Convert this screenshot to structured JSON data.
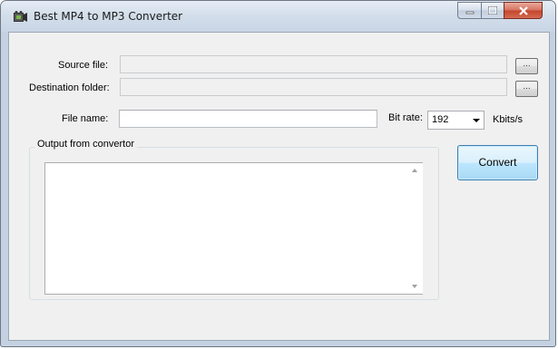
{
  "window": {
    "title": "Best MP4 to MP3 Converter",
    "app_icon": "film-icon",
    "controls": [
      "minimize-icon",
      "maximize-icon",
      "close-icon"
    ]
  },
  "form": {
    "source_file": {
      "label": "Source file:",
      "value": "",
      "browse_label": "..."
    },
    "destination_folder": {
      "label": "Destination folder:",
      "value": "",
      "browse_label": "..."
    },
    "file_name": {
      "label": "File name:",
      "value": ""
    },
    "bit_rate": {
      "label": "Bit rate:",
      "selected": "192",
      "unit": "Kbits/s"
    }
  },
  "output": {
    "group_label": "Output from convertor",
    "text": ""
  },
  "actions": {
    "convert_label": "Convert"
  },
  "colors": {
    "accent": "#3c7fb1",
    "close_button": "#c4442c",
    "client_bg": "#f0f0f0"
  }
}
